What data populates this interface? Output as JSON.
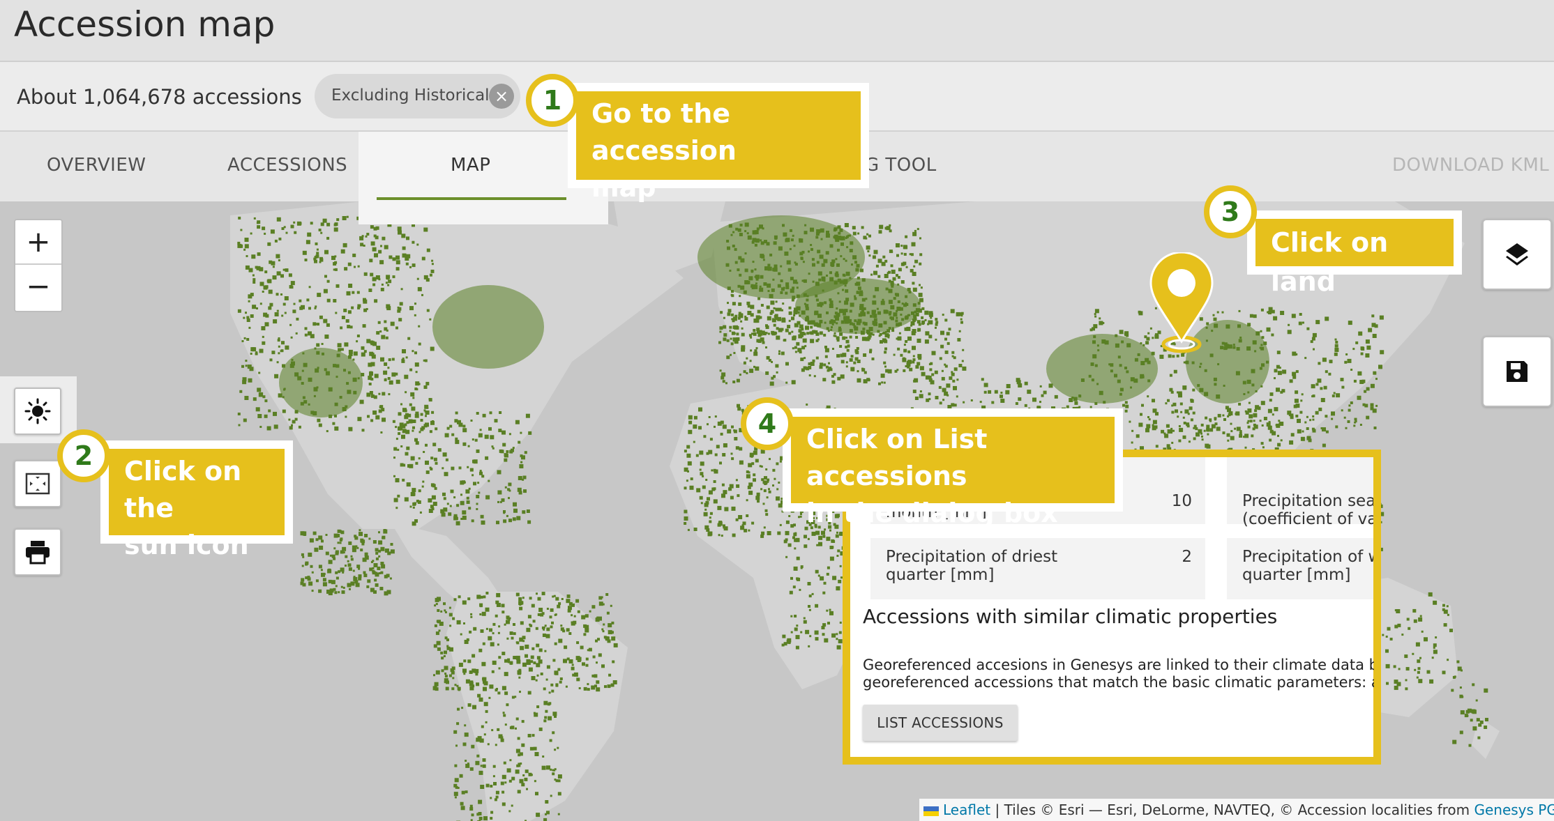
{
  "header": {
    "title": "Accession map"
  },
  "summary": {
    "count_text": "About 1,064,678 accessions",
    "filter_chip": "Excluding Historical"
  },
  "tabs": {
    "overview": "OVERVIEW",
    "accessions": "ACCESSIONS",
    "map": "MAP",
    "tool_partial": "G TOOL",
    "download": "DOWNLOAD KML"
  },
  "map_controls": {
    "zoom_in": "+",
    "zoom_out": "−"
  },
  "popup": {
    "partial_label": "month [mm]",
    "row1_value": "10",
    "row1_right_label_line1": "Precipitation seas",
    "row1_right_label_line2": "(coefficient of vari",
    "row2_label_line1": "Precipitation of driest",
    "row2_label_line2": "quarter [mm]",
    "row2_value": "2",
    "row2_right_label_line1": "Precipitation of wa",
    "row2_right_label_line2": "quarter [mm]",
    "section_heading": "Accessions with similar climatic properties",
    "description_line1": "Georeferenced accesions in Genesys are linked to their climate data bas",
    "description_line2": "georeferenced accessions that match the basic climatic parameters: ann",
    "list_button": "LIST ACCESSIONS"
  },
  "attribution": {
    "leaflet": "Leaflet",
    "text": " | Tiles © Esri — Esri, DeLorme, NAVTEQ, © Accession localities from ",
    "genesys": "Genesys PGR"
  },
  "callouts": [
    {
      "number": "1",
      "line1": "Go to the accession",
      "line2": "map"
    },
    {
      "number": "2",
      "line1": "Click on the",
      "line2": "sun icon"
    },
    {
      "number": "3",
      "line1": "Click on land"
    },
    {
      "number": "4",
      "line1": "Click on List accessions",
      "line2": "in the dialog box"
    }
  ],
  "colors": {
    "accent_yellow": "#e6c01c",
    "point_green": "#5a7f24",
    "badge_number": "#2f7a1a",
    "map_background": "#c7c7c7",
    "land": "#d6d6d6"
  },
  "icons": [
    "sun-icon",
    "fit-bounds-icon",
    "print-icon",
    "layers-icon",
    "save-icon",
    "close-icon",
    "map-pin-icon"
  ]
}
